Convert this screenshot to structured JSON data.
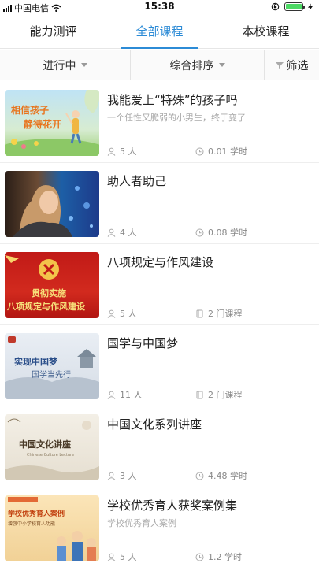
{
  "status_bar": {
    "carrier": "中国电信",
    "time": "15:38"
  },
  "tabs": [
    {
      "label": "能力测评",
      "active": false
    },
    {
      "label": "全部课程",
      "active": true
    },
    {
      "label": "本校课程",
      "active": false
    }
  ],
  "filters": {
    "status": "进行中",
    "sort": "综合排序",
    "filter": "筛选"
  },
  "accent_color": "#2c8bd6",
  "courses": [
    {
      "title": "我能爱上“特殊”的孩子吗",
      "subtitle": "一个任性又脆弱的小男生，终于变了",
      "learners": "5 人",
      "meta": "0.01 学时",
      "meta_icon": "clock-icon",
      "thumb_text": [
        "相信孩子",
        "静待花开"
      ]
    },
    {
      "title": "助人者助己",
      "subtitle": "",
      "learners": "4 人",
      "meta": "0.08 学时",
      "meta_icon": "clock-icon",
      "thumb_text": []
    },
    {
      "title": "八项规定与作风建设",
      "subtitle": "",
      "learners": "5 人",
      "meta": "2 门课程",
      "meta_icon": "book-icon",
      "thumb_text": [
        "贯彻实施",
        "八项规定与作风建设"
      ]
    },
    {
      "title": "国学与中国梦",
      "subtitle": "",
      "learners": "11 人",
      "meta": "2 门课程",
      "meta_icon": "book-icon",
      "thumb_text": [
        "实现中国梦",
        "国学当先行"
      ]
    },
    {
      "title": "中国文化系列讲座",
      "subtitle": "",
      "learners": "3 人",
      "meta": "4.48 学时",
      "meta_icon": "clock-icon",
      "thumb_text": [
        "中国文化讲座",
        "Chinese Culture Lecture"
      ]
    },
    {
      "title": "学校优秀育人获奖案例集",
      "subtitle": "学校优秀育人案例",
      "learners": "5 人",
      "meta": "1.2 学时",
      "meta_icon": "clock-icon",
      "thumb_text": [
        "学校优秀育人案例",
        "增强中小学校育人功能"
      ]
    }
  ]
}
